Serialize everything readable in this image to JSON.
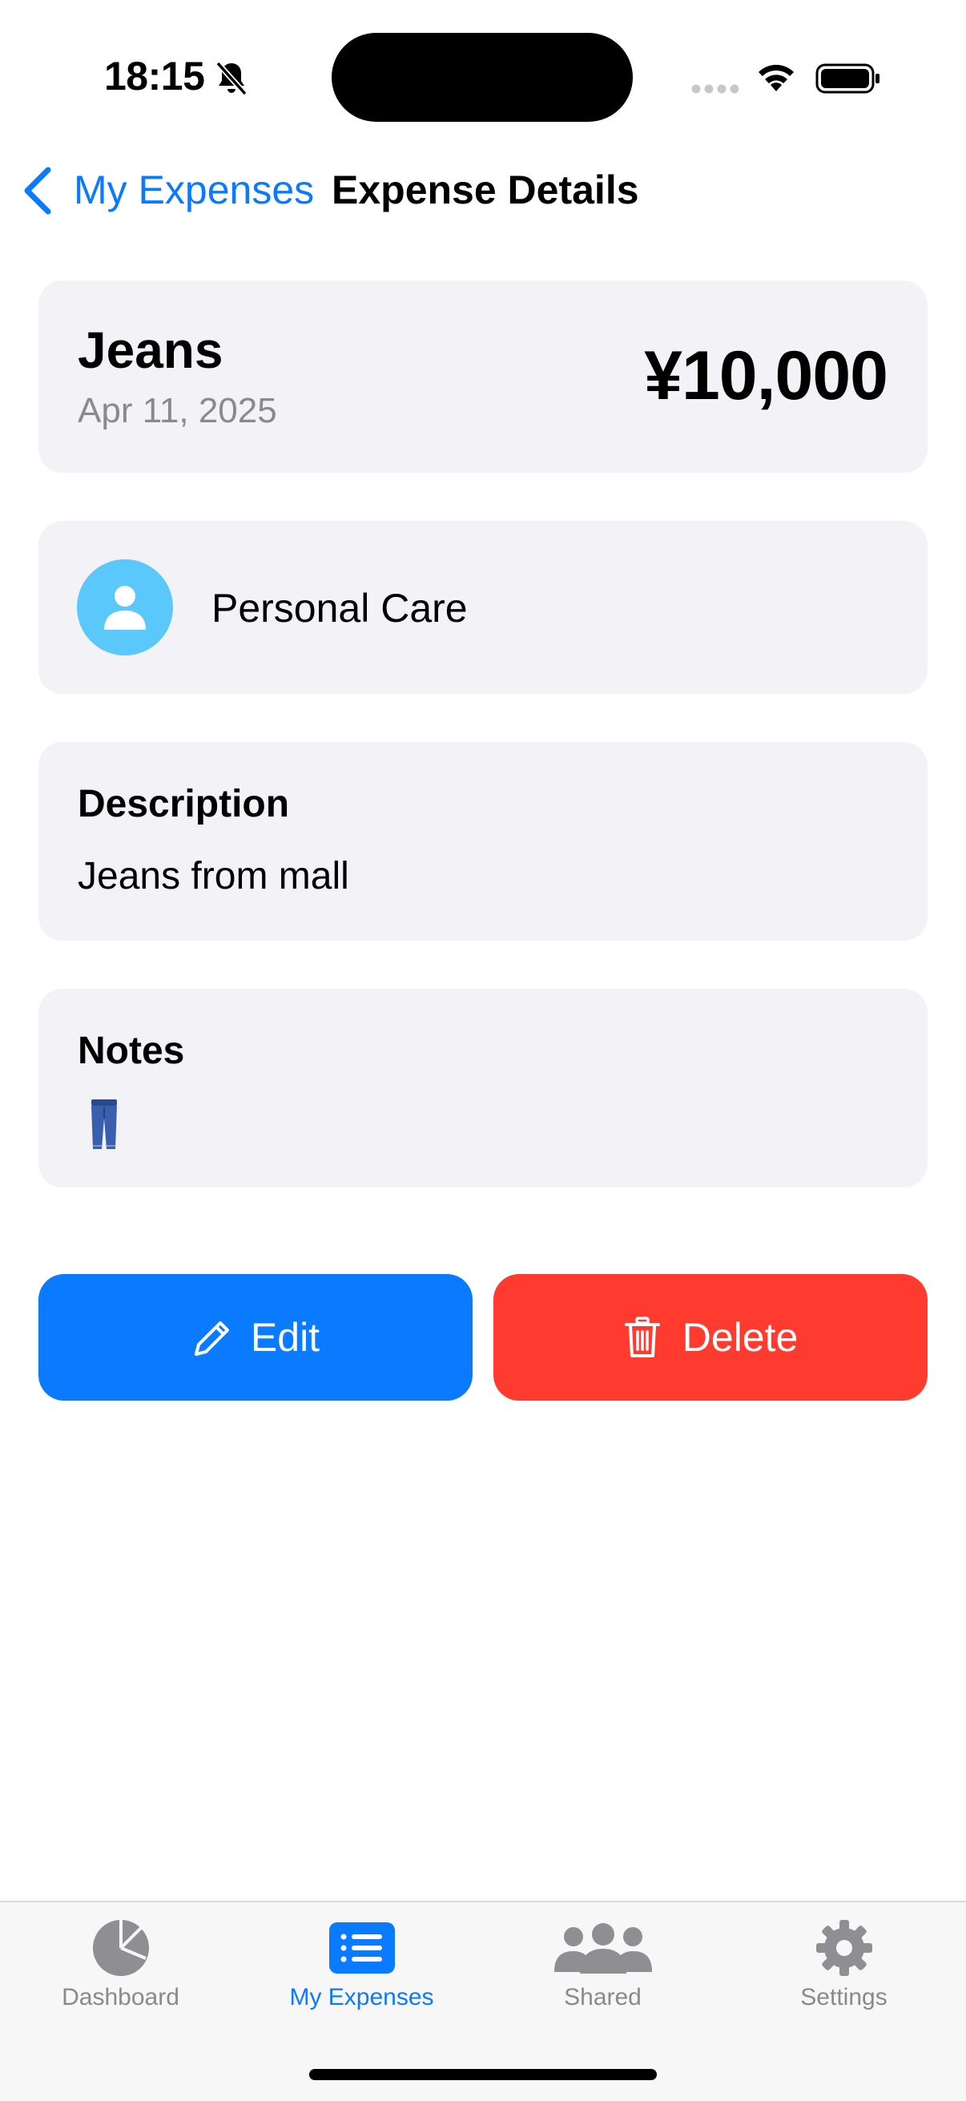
{
  "status_bar": {
    "time": "18:15"
  },
  "nav": {
    "back_label": "My Expenses",
    "title": "Expense Details"
  },
  "expense": {
    "title": "Jeans",
    "date": "Apr 11, 2025",
    "amount": "¥10,000"
  },
  "category": {
    "label": "Personal Care",
    "icon": "person-icon",
    "color": "#5ac8fa"
  },
  "description": {
    "heading": "Description",
    "text": "Jeans from mall"
  },
  "notes": {
    "heading": "Notes",
    "content_icon": "jeans-emoji"
  },
  "actions": {
    "edit_label": "Edit",
    "delete_label": "Delete",
    "edit_color": "#0a7aff",
    "delete_color": "#ff3b30"
  },
  "tabs": [
    {
      "label": "Dashboard",
      "icon": "pie-chart-icon",
      "active": false
    },
    {
      "label": "My Expenses",
      "icon": "list-icon",
      "active": true
    },
    {
      "label": "Shared",
      "icon": "people-icon",
      "active": false
    },
    {
      "label": "Settings",
      "icon": "gear-icon",
      "active": false
    }
  ],
  "colors": {
    "accent": "#0a7aff",
    "card_bg": "#f2f2f7",
    "secondary_text": "#8a8a8e"
  }
}
